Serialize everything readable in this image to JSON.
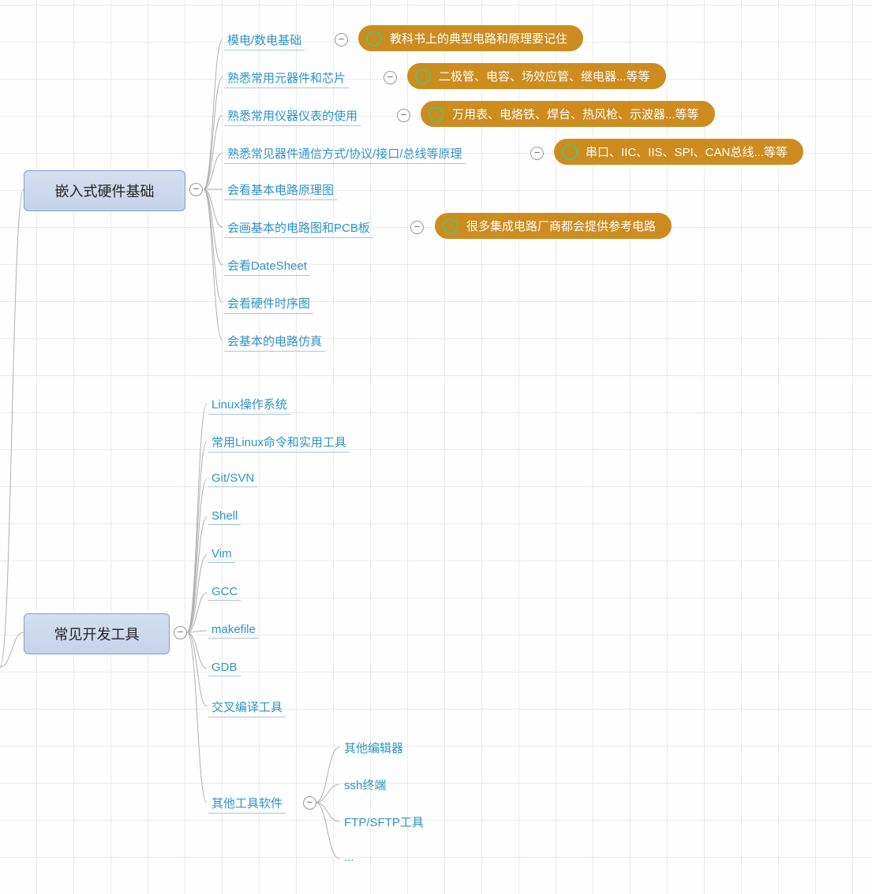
{
  "roots": {
    "r1": "嵌入式硬件基础",
    "r2": "常见开发工具"
  },
  "hw": {
    "c0": "模电/数电基础",
    "c1": "熟悉常用元器件和芯片",
    "c2": "熟悉常用仪器仪表的使用",
    "c3": "熟悉常见器件通信方式/协议/接口/总线等原理",
    "c4": "会看基本电路原理图",
    "c5": "会画基本的电路图和PCB板",
    "c6": "会看DateSheet",
    "c7": "会看硬件时序图",
    "c8": "会基本的电路仿真"
  },
  "hw_notes": {
    "n0": "教科书上的典型电路和原理要记住",
    "n1": "二极管、电容、场效应管、继电器...等等",
    "n2": "万用表、电烙铁、焊台、热风枪、示波器...等等",
    "n3": "串口、IIC、IIS、SPI、CAN总线...等等",
    "n5": "很多集成电路厂商都会提供参考电路"
  },
  "tools": {
    "t0": "Linux操作系统",
    "t1": "常用Linux命令和实用工具",
    "t2": "Git/SVN",
    "t3": "Shell",
    "t4": "Vim",
    "t5": "GCC",
    "t6": "makefile",
    "t7": "GDB",
    "t8": "交叉编译工具",
    "t9": "其他工具软件"
  },
  "other": {
    "o0": "其他编辑器",
    "o1": "ssh终端",
    "o2": "FTP/SFTP工具",
    "o3": "..."
  }
}
